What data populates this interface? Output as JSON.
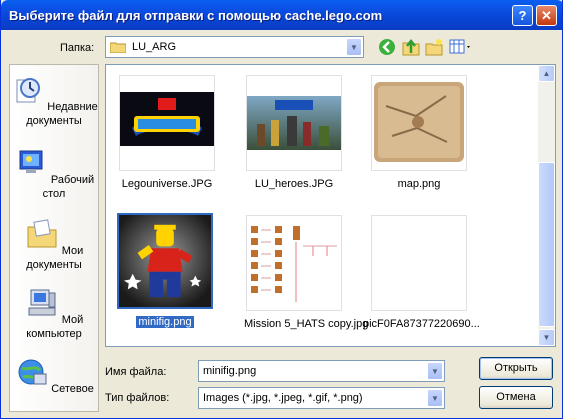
{
  "window": {
    "title": "Выберите файл для отправки с помощью cache.lego.com",
    "help": "?",
    "close": "✕"
  },
  "toolbar": {
    "folder_label": "Папка:",
    "folder_value": "LU_ARG"
  },
  "places": [
    {
      "label": "Недавние документы",
      "icon": "recent-documents-icon"
    },
    {
      "label": "Рабочий стол",
      "icon": "desktop-icon"
    },
    {
      "label": "Мои документы",
      "icon": "my-documents-icon"
    },
    {
      "label": "Мой компьютер",
      "icon": "my-computer-icon"
    },
    {
      "label": "Сетевое",
      "icon": "network-icon"
    }
  ],
  "files": [
    {
      "name": "Legouniverse.JPG",
      "selected": false
    },
    {
      "name": "LU_heroes.JPG",
      "selected": false
    },
    {
      "name": "map.png",
      "selected": false
    },
    {
      "name": "minifig.png",
      "selected": true
    },
    {
      "name": "Mission 5_HATS copy.jpg",
      "selected": false
    },
    {
      "name": "picF0FA87377220690...",
      "selected": false
    }
  ],
  "form": {
    "filename_label": "Имя файла:",
    "filename_value": "minifig.png",
    "filetype_label": "Тип файлов:",
    "filetype_value": "Images (*.jpg, *.jpeg, *.gif, *.png)",
    "open_label": "Открыть",
    "cancel_label": "Отмена"
  },
  "colors": {
    "titlebar": "#0a4ce0",
    "selection": "#316ac5",
    "dialog_bg": "#ece9d8"
  }
}
